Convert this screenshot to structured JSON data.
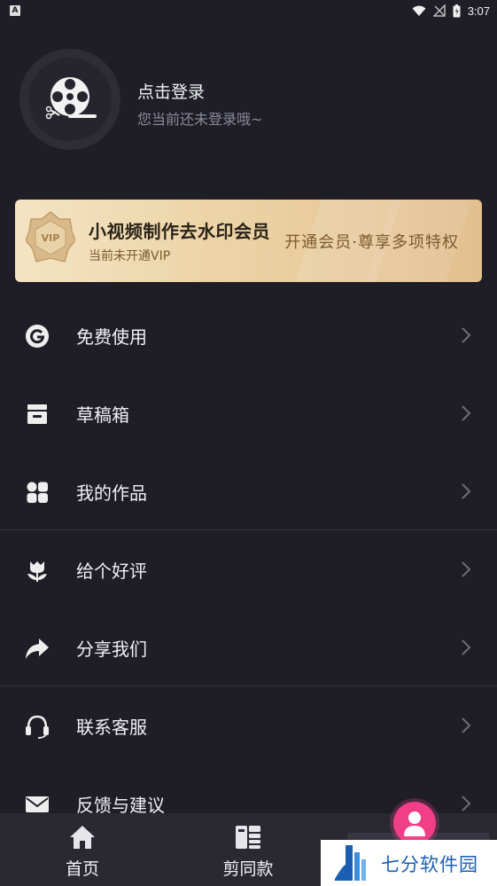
{
  "status_bar": {
    "time": "3:07",
    "notification_icon": "A"
  },
  "profile": {
    "login_title": "点击登录",
    "login_subtitle": "您当前还未登录哦~"
  },
  "vip_banner": {
    "title": "小视频制作去水印会员",
    "subtitle": "当前未开通VIP",
    "promo": "开通会员·尊享多项特权",
    "badge_text": "VIP",
    "colors": {
      "gold_light": "#f4e3c3",
      "gold_dark": "#e2c090",
      "text_brown": "#7b5a2c"
    }
  },
  "menu": [
    {
      "label": "免费使用",
      "icon": "google-g-icon"
    },
    {
      "label": "草稿箱",
      "icon": "drafts-box-icon"
    },
    {
      "label": "我的作品",
      "icon": "works-grid-icon"
    },
    {
      "label": "给个好评",
      "icon": "flower-icon"
    },
    {
      "label": "分享我们",
      "icon": "share-arrow-icon"
    },
    {
      "label": "联系客服",
      "icon": "headset-icon"
    },
    {
      "label": "反馈与建议",
      "icon": "envelope-icon"
    }
  ],
  "tab_bar": {
    "tabs": [
      {
        "label": "首页",
        "icon": "home-icon"
      },
      {
        "label": "剪同款",
        "icon": "template-icon"
      }
    ]
  },
  "watermark": {
    "text": "七分软件园"
  },
  "theme": {
    "background": "#1f1e27",
    "fab_color": "#f03e87",
    "watermark_blue": "#1a5fb4"
  }
}
